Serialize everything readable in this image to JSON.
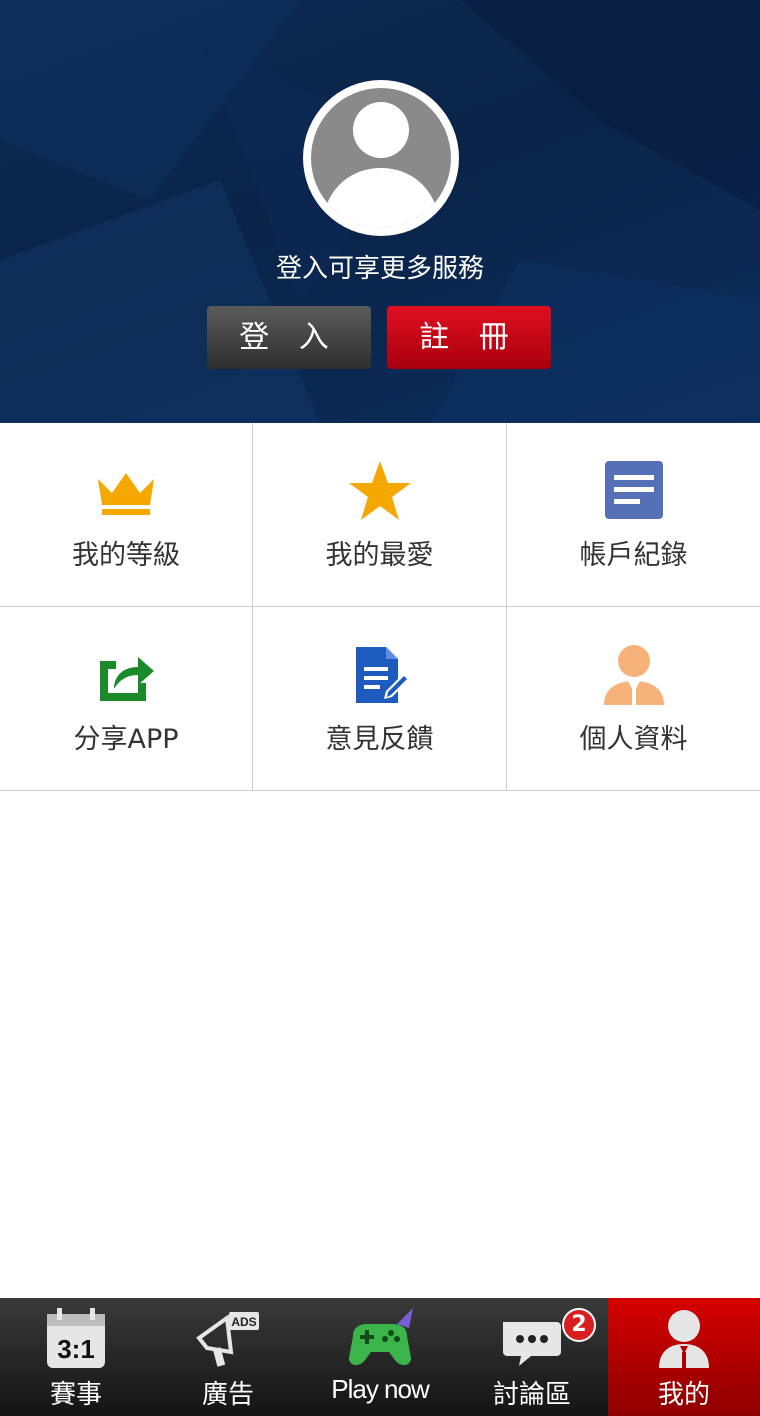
{
  "header": {
    "login_prompt": "登入可享更多服務",
    "login_label": "登 入",
    "register_label": "註 冊"
  },
  "menu": [
    {
      "label": "我的等級",
      "icon": "crown-icon",
      "color": "#f5a800"
    },
    {
      "label": "我的最愛",
      "icon": "star-icon",
      "color": "#f5a800"
    },
    {
      "label": "帳戶紀錄",
      "icon": "document-lines-icon",
      "color": "#5670b8"
    },
    {
      "label": "分享APP",
      "icon": "share-icon",
      "color": "#1b8a2a"
    },
    {
      "label": "意見反饋",
      "icon": "edit-document-icon",
      "color": "#1e5bbf"
    },
    {
      "label": "個人資料",
      "icon": "person-icon",
      "color": "#f7b27a"
    }
  ],
  "bottom_nav": {
    "items": [
      {
        "label": "賽事",
        "icon": "calendar-score-icon",
        "icon_text": "3:1"
      },
      {
        "label": "廣告",
        "icon": "ads-megaphone-icon",
        "icon_text": "ADS"
      },
      {
        "label": "Play now",
        "icon": "gamepad-icon"
      },
      {
        "label": "討論區",
        "icon": "chat-bubble-icon",
        "badge": "2"
      },
      {
        "label": "我的",
        "icon": "user-icon",
        "active": true
      }
    ]
  },
  "colors": {
    "header_bg": "#0a2448",
    "register": "#c8001a",
    "active_tab": "#c40000"
  }
}
